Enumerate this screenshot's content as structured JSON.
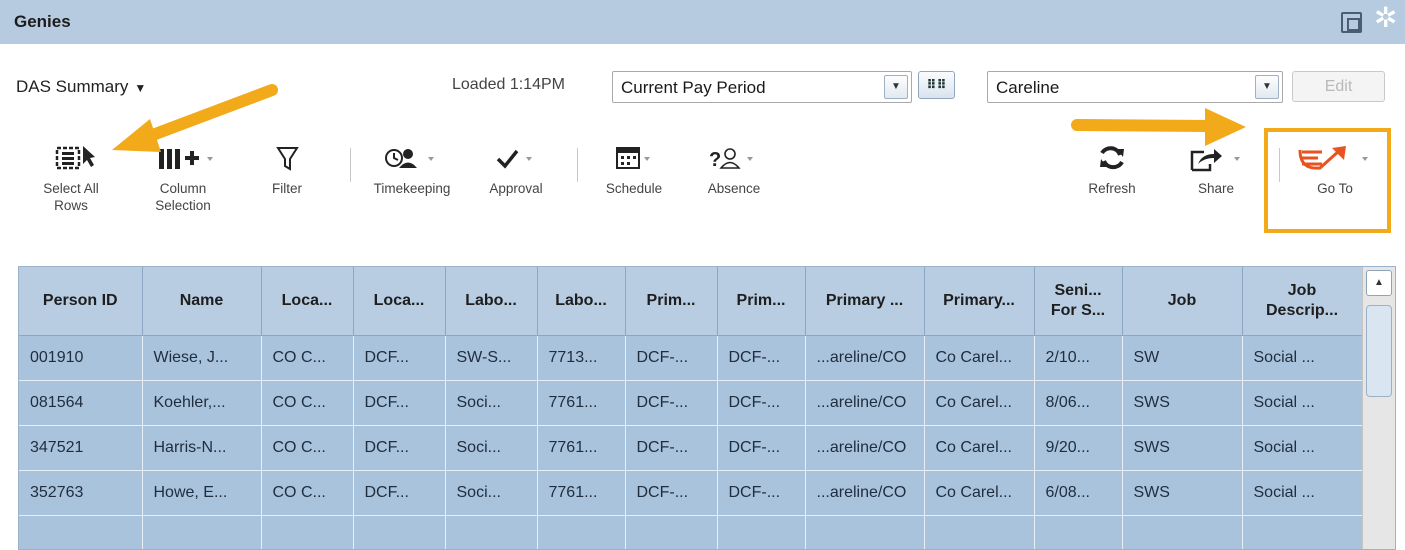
{
  "titlebar": {
    "title": "Genies",
    "window_icon": "window-restore-icon",
    "settings_icon": "gear-icon"
  },
  "controls": {
    "view_name": "DAS Summary",
    "loaded_text": "Loaded 1:14PM",
    "period_value": "Current Pay Period",
    "location_value": "Careline",
    "edit_label": "Edit"
  },
  "toolbar": [
    {
      "label_1": "Select All",
      "label_2": "Rows",
      "icon": "select-all-icon"
    },
    {
      "label_1": "Column",
      "label_2": "Selection",
      "icon": "column-add-icon"
    },
    {
      "label_1": "Filter",
      "label_2": "",
      "icon": "filter-icon"
    },
    {
      "label_1": "Timekeeping",
      "label_2": "",
      "icon": "timekeeping-icon"
    },
    {
      "label_1": "Approval",
      "label_2": "",
      "icon": "checkmark-icon"
    },
    {
      "label_1": "Schedule",
      "label_2": "",
      "icon": "calendar-icon"
    },
    {
      "label_1": "Absence",
      "label_2": "",
      "icon": "absence-icon"
    },
    {
      "label_1": "Refresh",
      "label_2": "",
      "icon": "refresh-icon"
    },
    {
      "label_1": "Share",
      "label_2": "",
      "icon": "share-icon"
    },
    {
      "label_1": "Go To",
      "label_2": "",
      "icon": "goto-icon"
    }
  ],
  "table": {
    "headers": [
      [
        "Person ID",
        ""
      ],
      [
        "Name",
        ""
      ],
      [
        "Loca...",
        ""
      ],
      [
        "Loca...",
        ""
      ],
      [
        "Labo...",
        ""
      ],
      [
        "Labo...",
        ""
      ],
      [
        "Prim...",
        ""
      ],
      [
        "Prim...",
        ""
      ],
      [
        "Primary ...",
        ""
      ],
      [
        "Primary...",
        ""
      ],
      [
        "Seni...",
        "For S..."
      ],
      [
        "Job",
        ""
      ],
      [
        "Job",
        "Descrip..."
      ]
    ],
    "rows": [
      [
        "001910",
        "Wiese, J...",
        "CO C...",
        "DCF...",
        "SW-S...",
        "7713...",
        "DCF-...",
        "DCF-...",
        "...areline/CO",
        "Co Carel...",
        "2/10...",
        "SW",
        "Social ..."
      ],
      [
        "081564",
        "Koehler,...",
        "CO C...",
        "DCF...",
        "Soci...",
        "7761...",
        "DCF-...",
        "DCF-...",
        "...areline/CO",
        "Co Carel...",
        "8/06...",
        "SWS",
        "Social ..."
      ],
      [
        "347521",
        "Harris-N...",
        "CO C...",
        "DCF...",
        "Soci...",
        "7761...",
        "DCF-...",
        "DCF-...",
        "...areline/CO",
        "Co Carel...",
        "9/20...",
        "SWS",
        "Social ..."
      ],
      [
        "352763",
        "Howe, E...",
        "CO C...",
        "DCF...",
        "Soci...",
        "7761...",
        "DCF-...",
        "DCF-...",
        "...areline/CO",
        "Co Carel...",
        "6/08...",
        "SWS",
        "Social ..."
      ],
      [
        "",
        "",
        "",
        "",
        "",
        "",
        "",
        "",
        "",
        "",
        "",
        "",
        ""
      ]
    ]
  },
  "colors": {
    "titlebar": "#b7cbe0",
    "highlight": "#f2a91a",
    "row_bg": "#a9c3dd",
    "header_bg": "#b9cde2",
    "goto_accent": "#e8541f"
  }
}
